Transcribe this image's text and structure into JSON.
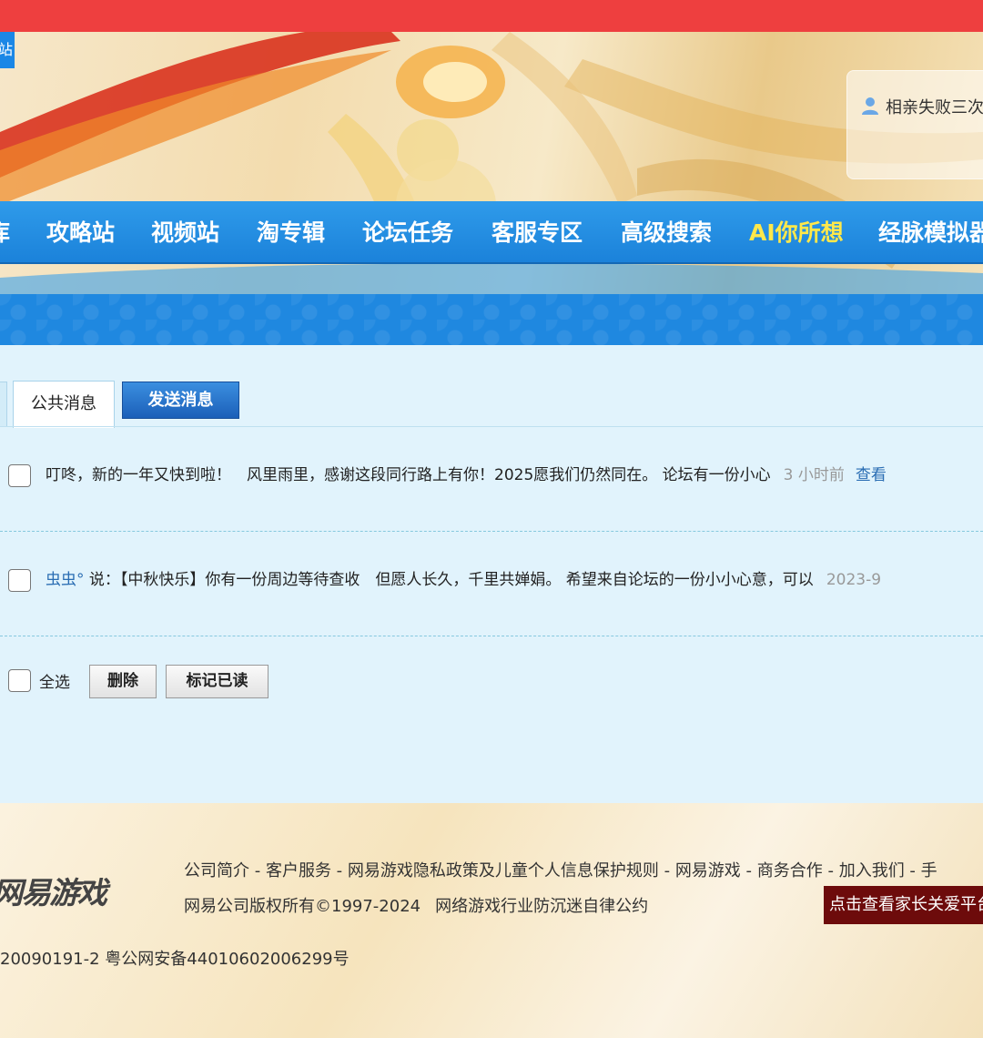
{
  "site_tag": "站",
  "user": {
    "name": "相亲失败三次"
  },
  "nav": {
    "items": [
      {
        "label": "库"
      },
      {
        "label": "攻略站"
      },
      {
        "label": "视频站"
      },
      {
        "label": "淘专辑"
      },
      {
        "label": "论坛任务"
      },
      {
        "label": "客服专区"
      },
      {
        "label": "高级搜索"
      },
      {
        "label": "AI你所想"
      },
      {
        "label": "经脉模拟器"
      }
    ]
  },
  "tabs": {
    "public": "公共消息",
    "send": "发送消息"
  },
  "messages": [
    {
      "author": "",
      "text": "叮咚，新的一年又快到啦！　风里雨里，感谢这段同行路上有你！2025愿我们仍然同在。 论坛有一份小心",
      "time": "3 小时前",
      "view": "查看"
    },
    {
      "author": "虫虫°",
      "text": " 说：【中秋快乐】你有一份周边等待查收　但愿人长久，千里共婵娟。 希望来自论坛的一份小小心意，可以",
      "time": "2023-9",
      "view": ""
    }
  ],
  "actions": {
    "select_all": "全选",
    "delete": "删除",
    "mark_read": "标记已读"
  },
  "footer": {
    "logo": "网易游戏",
    "links": "公司简介 - 客户服务 - 网易游戏隐私政策及儿童个人信息保护规则 - 网易游戏 - 商务合作 - 加入我们 - 手",
    "copyright": "网易公司版权所有©1997-2024",
    "selfdiscipline": "网络游戏行业防沉迷自律公约",
    "parent_btn": "点击查看家长关爱平台",
    "icp": "20090191-2 粤公网安备44010602006299号"
  },
  "colors": {
    "topbar": "#ee3f3f",
    "nav": "#1b82da",
    "nav_highlight": "#ffe84a",
    "content_bg": "#e1f3fc",
    "link": "#2a6db3"
  }
}
